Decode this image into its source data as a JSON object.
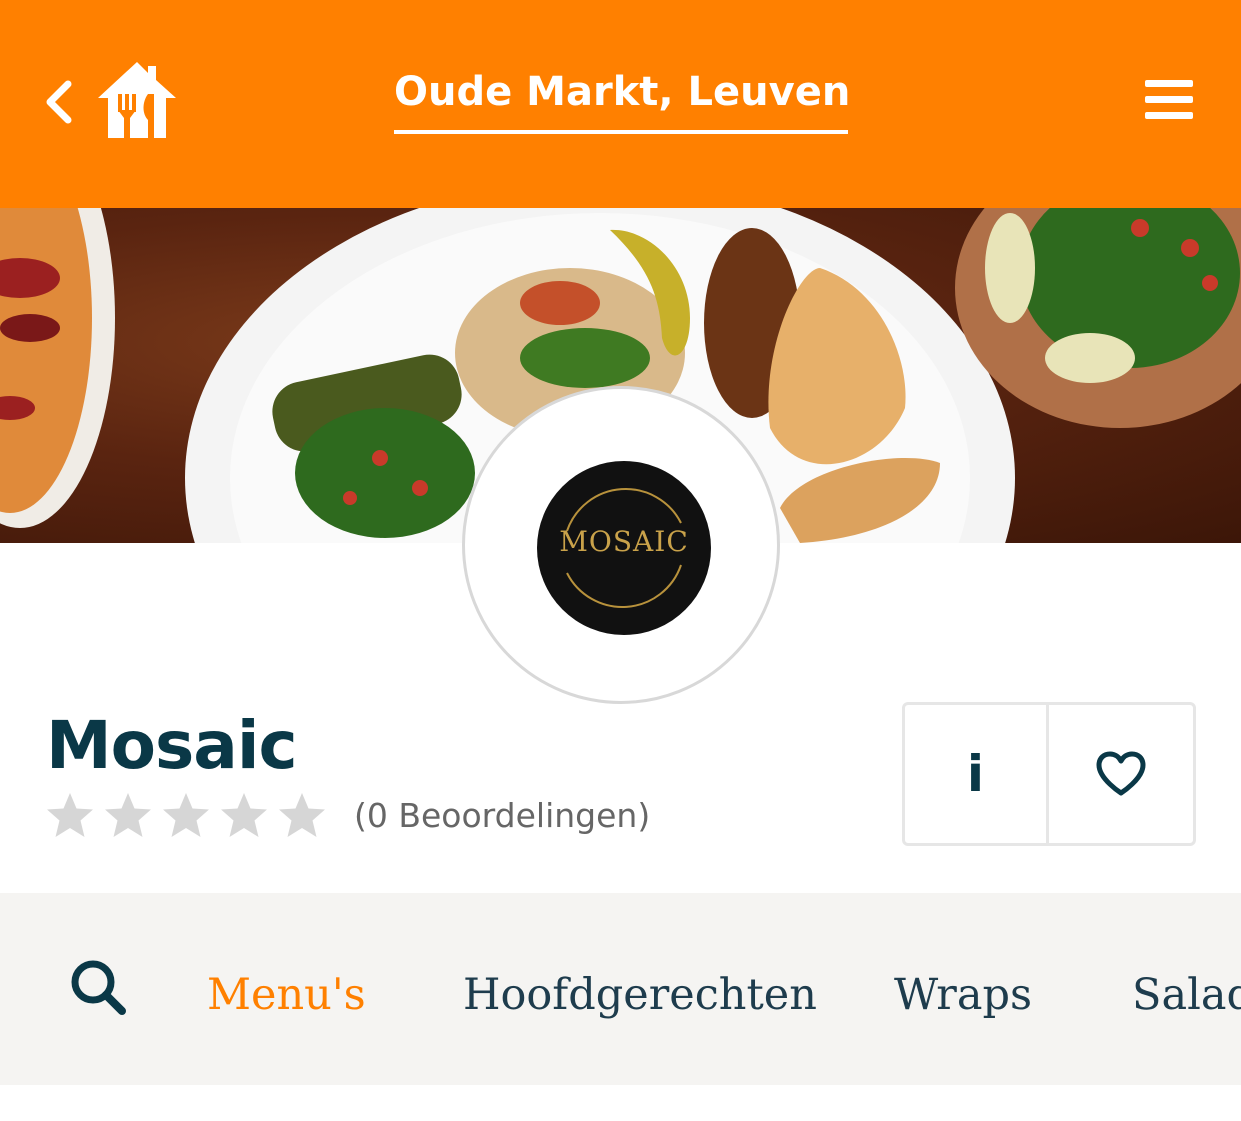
{
  "header": {
    "location": "Oude Markt, Leuven",
    "back_icon": "chevron-left-icon",
    "logo_icon": "house-cutlery-logo",
    "menu_icon": "hamburger-menu-icon",
    "background_color": "#ff8000"
  },
  "restaurant": {
    "logo_text": "MOSAIC",
    "name": "Mosaic",
    "rating": 0,
    "rating_max": 5,
    "reviews_text": "(0 Beoordelingen)",
    "info_label": "i",
    "favorite_icon": "heart-outline-icon"
  },
  "categories": {
    "search_icon": "search-icon",
    "items": [
      "Menu's",
      "Hoofdgerechten",
      "Wraps",
      "Salad"
    ],
    "active_index": 0,
    "active_color": "#ff8000"
  }
}
